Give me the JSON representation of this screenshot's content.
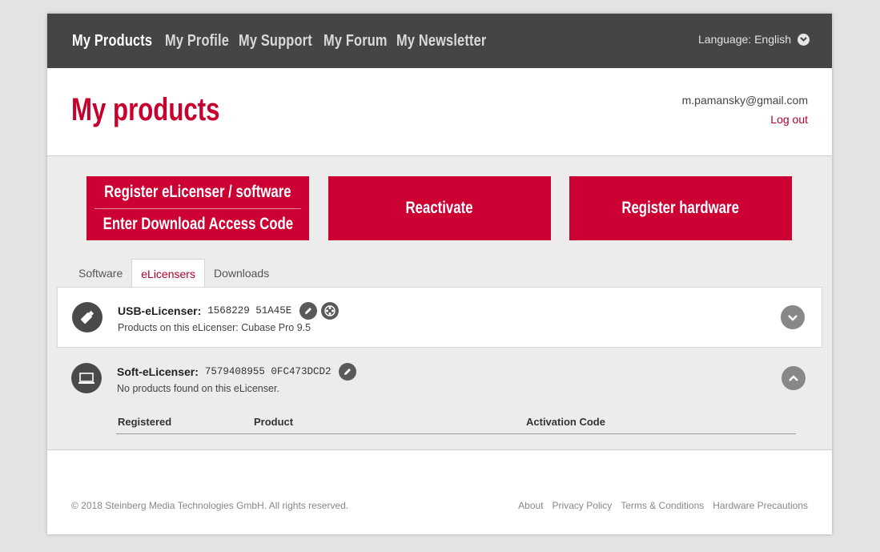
{
  "nav": {
    "items": [
      "My Products",
      "My Profile",
      "My Support",
      "My Forum",
      "My Newsletter"
    ],
    "language_label": "Language: English"
  },
  "header": {
    "title": "My products",
    "email": "m.pamansky@gmail.com",
    "logout": "Log out"
  },
  "actions": {
    "register_elicenser": "Register eLicenser / software",
    "enter_code": "Enter Download Access Code",
    "reactivate": "Reactivate",
    "register_hardware": "Register hardware"
  },
  "tabs": [
    "Software",
    "eLicensers",
    "Downloads"
  ],
  "licensers": {
    "usb": {
      "name": "USB-eLicenser:",
      "serial": "1568229 51A45E",
      "products": "Products on this eLicenser: Cubase Pro 9.5"
    },
    "soft": {
      "name": "Soft-eLicenser:",
      "serial": "7579408955 0FC473DCD2",
      "products": "No products found on this eLicenser.",
      "columns": [
        "Registered",
        "Product",
        "Activation Code"
      ]
    }
  },
  "footer": {
    "copyright": "© 2018 Steinberg Media Technologies GmbH. All rights reserved.",
    "links": [
      "About",
      "Privacy Policy",
      "Terms & Conditions",
      "Hardware Precautions"
    ]
  },
  "colors": {
    "accent": "#cc0033",
    "nav_bg": "#454545",
    "content_bg": "#ececec"
  }
}
